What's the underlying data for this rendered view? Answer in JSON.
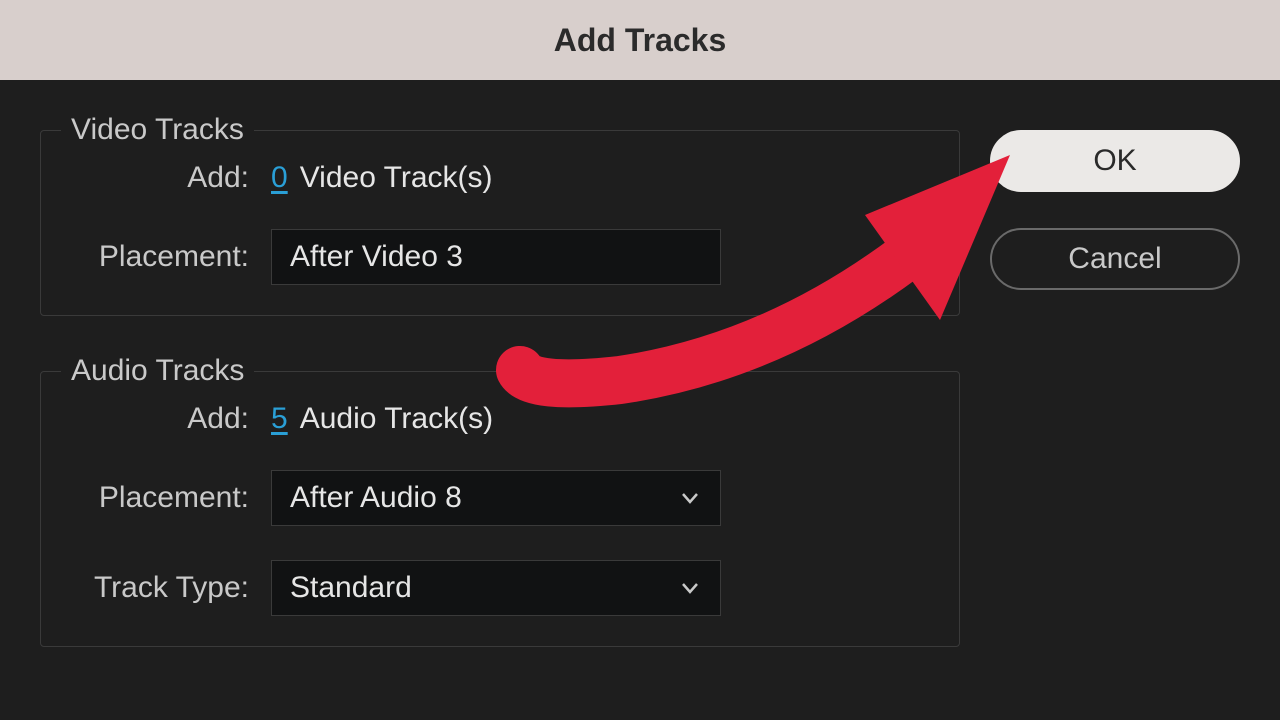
{
  "titlebar": {
    "title": "Add Tracks"
  },
  "video": {
    "legend": "Video Tracks",
    "add_label": "Add:",
    "count": "0",
    "unit": "Video Track(s)",
    "placement_label": "Placement:",
    "placement_value": "After Video 3"
  },
  "audio": {
    "legend": "Audio Tracks",
    "add_label": "Add:",
    "count": "5",
    "unit": "Audio Track(s)",
    "placement_label": "Placement:",
    "placement_value": "After Audio 8",
    "track_type_label": "Track Type:",
    "track_type_value": "Standard"
  },
  "buttons": {
    "ok": "OK",
    "cancel": "Cancel"
  },
  "annotation": {
    "arrow_color": "#e3203a"
  }
}
